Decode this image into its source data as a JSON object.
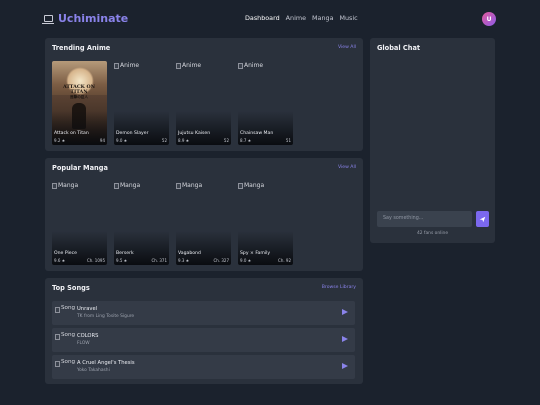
{
  "app": {
    "name": "Uchiminate",
    "avatar_initial": "U"
  },
  "nav": [
    {
      "label": "Dashboard",
      "active": true
    },
    {
      "label": "Anime",
      "active": false
    },
    {
      "label": "Manga",
      "active": false
    },
    {
      "label": "Music",
      "active": false
    }
  ],
  "trending": {
    "title": "Trending Anime",
    "view_all": "View All",
    "items": [
      {
        "name": "Attack on Titan",
        "rating": "9.2 ★",
        "extra": "94",
        "poster_text": "ATTACK ON TITAN",
        "poster_sub": "進撃の巨人"
      },
      {
        "name": "Demon Slayer",
        "rating": "9.0 ★",
        "extra": "52",
        "alt": "Anime"
      },
      {
        "name": "Jujutsu Kaisen",
        "rating": "8.9 ★",
        "extra": "52",
        "alt": "Anime"
      },
      {
        "name": "Chainsaw Man",
        "rating": "8.7 ★",
        "extra": "51",
        "alt": "Anime"
      }
    ]
  },
  "popular": {
    "title": "Popular Manga",
    "view_all": "View All",
    "items": [
      {
        "name": "One Piece",
        "rating": "9.6 ★",
        "extra": "Ch. 1095",
        "alt": "Manga"
      },
      {
        "name": "Berserk",
        "rating": "9.5 ★",
        "extra": "Ch. 371",
        "alt": "Manga"
      },
      {
        "name": "Vagabond",
        "rating": "9.3 ★",
        "extra": "Ch. 327",
        "alt": "Manga"
      },
      {
        "name": "Spy × Family",
        "rating": "9.0 ★",
        "extra": "Ch. 92",
        "alt": "Manga"
      }
    ]
  },
  "songs": {
    "title": "Top Songs",
    "browse": "Browse Library",
    "items": [
      {
        "title": "Unravel",
        "artist": "TK from Ling Tosite Sigure",
        "alt": "Song"
      },
      {
        "title": "COLORS",
        "artist": "FLOW",
        "alt": "Song"
      },
      {
        "title": "A Cruel Angel's Thesis",
        "artist": "Yoko Takahashi",
        "alt": "Song"
      }
    ]
  },
  "chat": {
    "title": "Global Chat",
    "placeholder": "Say something...",
    "online": "42 fans online"
  },
  "colors": {
    "accent": "#8a83ea",
    "send": "#7b68ee",
    "background": "#1b222d",
    "card": "#2a313c"
  }
}
